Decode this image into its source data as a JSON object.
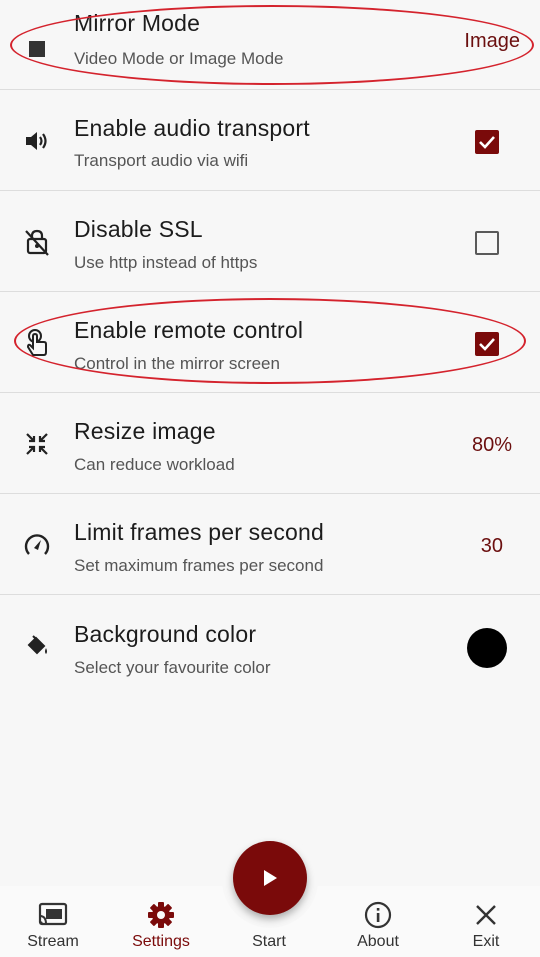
{
  "settings": {
    "items": [
      {
        "icon": "square-icon",
        "title": "Mirror Mode",
        "subtitle": "Video Mode or Image Mode",
        "value": "Image"
      },
      {
        "icon": "speaker-icon",
        "title": "Enable audio transport",
        "subtitle": "Transport audio via wifi",
        "checked": true
      },
      {
        "icon": "lock-off-icon",
        "title": "Disable SSL",
        "subtitle": "Use http instead of https",
        "checked": false
      },
      {
        "icon": "touch-icon",
        "title": "Enable remote control",
        "subtitle": "Control in the mirror screen",
        "checked": true
      },
      {
        "icon": "resize-icon",
        "title": "Resize image",
        "subtitle": "Can reduce workload",
        "value": "80%"
      },
      {
        "icon": "speedometer-icon",
        "title": "Limit frames per second",
        "subtitle": "Set maximum frames per second",
        "value": "30"
      },
      {
        "icon": "paint-bucket-icon",
        "title": "Background color",
        "subtitle": "Select your favourite color",
        "color": "#000000"
      }
    ]
  },
  "nav": {
    "items": [
      {
        "icon": "cast-icon",
        "label": "Stream",
        "active": false
      },
      {
        "icon": "gear-icon",
        "label": "Settings",
        "active": true
      },
      {
        "icon": "play-icon",
        "label": "Start",
        "active": false
      },
      {
        "icon": "info-icon",
        "label": "About",
        "active": false
      },
      {
        "icon": "close-icon",
        "label": "Exit",
        "active": false
      }
    ]
  },
  "colors": {
    "accent": "#7a0a0a",
    "highlight_ellipse": "#d4232d"
  }
}
